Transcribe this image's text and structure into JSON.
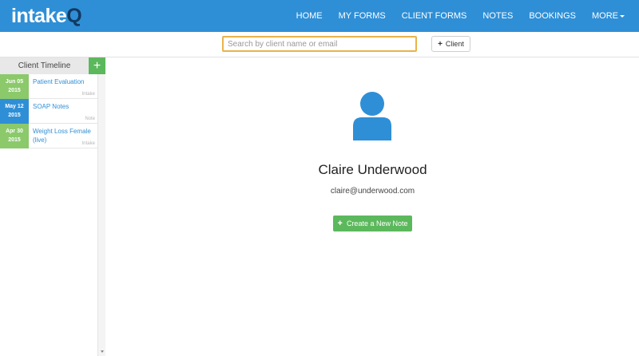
{
  "brand": {
    "name_prefix": "intake",
    "name_suffix": "Q"
  },
  "nav": {
    "items": [
      {
        "label": "HOME"
      },
      {
        "label": "MY FORMS"
      },
      {
        "label": "CLIENT FORMS"
      },
      {
        "label": "NOTES"
      },
      {
        "label": "BOOKINGS"
      },
      {
        "label": "MORE"
      }
    ]
  },
  "search": {
    "placeholder": "Search by client name or email",
    "value": ""
  },
  "toolbar": {
    "add_client_label": "Client",
    "add_client_icon": "plus-icon"
  },
  "sidebar": {
    "title": "Client Timeline",
    "add_icon": "plus-icon",
    "items": [
      {
        "date_month_day": "Jun 05",
        "date_year": "2015",
        "title": "Patient Evaluation",
        "type": "Intake",
        "color": "#8bc96b"
      },
      {
        "date_month_day": "May 12",
        "date_year": "2015",
        "title": "SOAP Notes",
        "type": "Note",
        "color": "#2f8fd6"
      },
      {
        "date_month_day": "Apr 30",
        "date_year": "2015",
        "title": "Weight Loss Female (live)",
        "type": "Intake",
        "color": "#8bc96b"
      }
    ]
  },
  "client": {
    "name": "Claire Underwood",
    "email": "claire@underwood.com",
    "avatar_icon": "user-icon",
    "avatar_color": "#2f8fd6"
  },
  "actions": {
    "create_note_label": "Create a New Note",
    "create_note_icon": "plus-icon"
  },
  "colors": {
    "primary": "#2f8fd6",
    "success": "#5cb85c",
    "search_focus": "#e8b34a"
  }
}
